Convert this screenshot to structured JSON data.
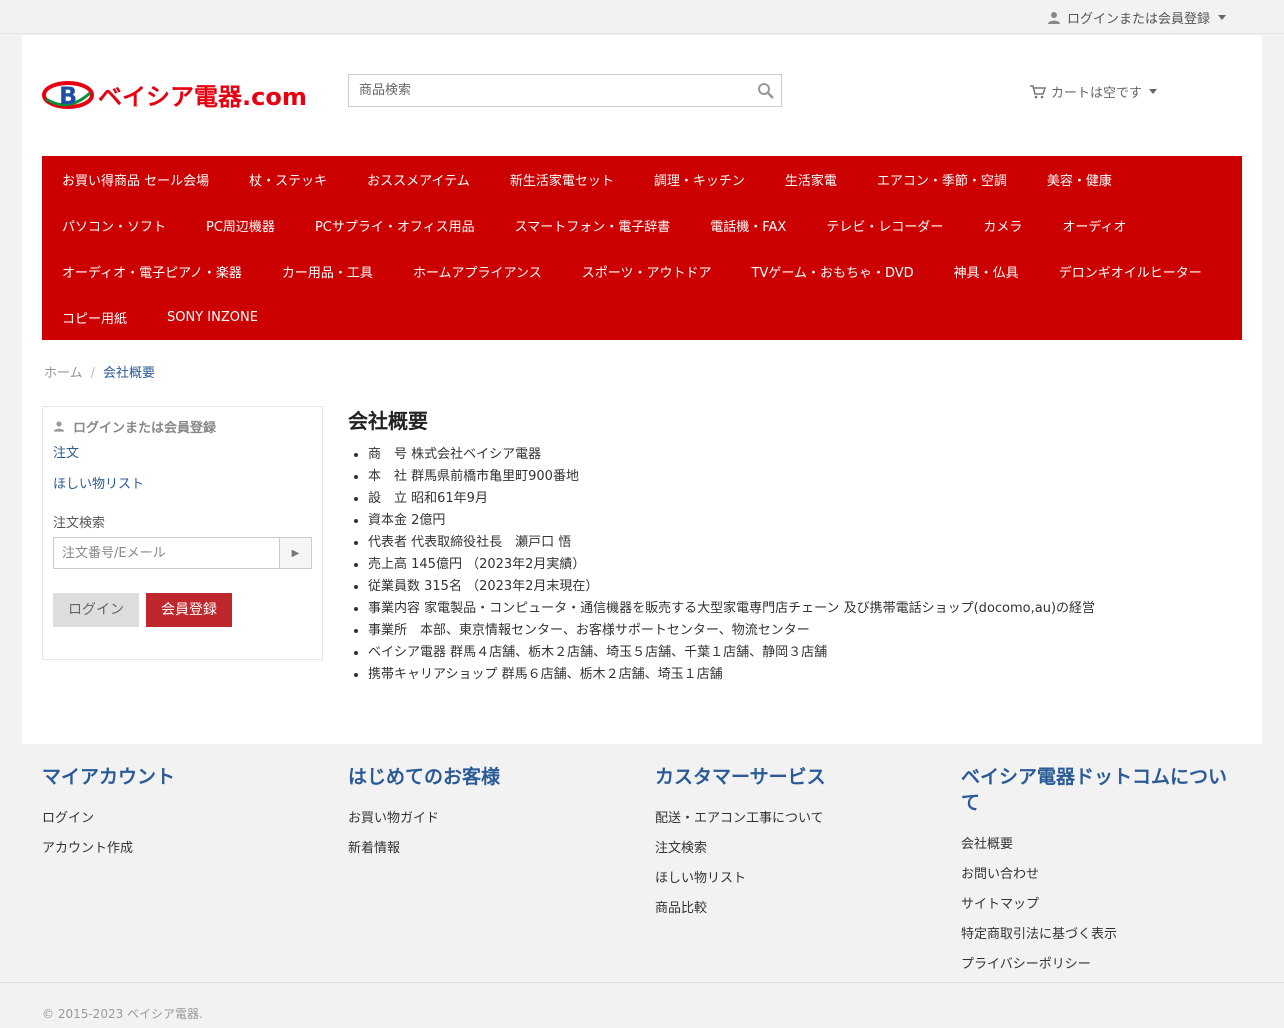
{
  "topbar": {
    "login_label": "ログインまたは会員登録"
  },
  "header": {
    "logo_text": "ベイシア電器.com",
    "search_placeholder": "商品検索",
    "cart_label": "カートは空です"
  },
  "nav": {
    "rows": [
      [
        "お買い得商品 セール会場",
        "杖・ステッキ",
        "おススメアイテム",
        "新生活家電セット",
        "調理・キッチン",
        "生活家電",
        "エアコン・季節・空調",
        "美容・健康"
      ],
      [
        "パソコン・ソフト",
        "PC周辺機器",
        "PCサプライ・オフィス用品",
        "スマートフォン・電子辞書",
        "電話機・FAX",
        "テレビ・レコーダー",
        "カメラ",
        "オーディオ"
      ],
      [
        "オーディオ・電子ピアノ・楽器",
        "カー用品・工具",
        "ホームアプライアンス",
        "スポーツ・アウトドア",
        "TVゲーム・おもちゃ・DVD",
        "神具・仏具",
        "デロンギオイルヒーター"
      ],
      [
        "コピー用紙",
        "SONY INZONE"
      ]
    ]
  },
  "breadcrumb": {
    "home": "ホーム",
    "sep": "/",
    "current": "会社概要"
  },
  "sidebar": {
    "login_label": "ログインまたは会員登録",
    "orders_link": "注文",
    "wishlist_link": "ほしい物リスト",
    "order_search_label": "注文検索",
    "order_search_placeholder": "注文番号/Eメール",
    "login_button": "ログイン",
    "register_button": "会員登録"
  },
  "main": {
    "title": "会社概要",
    "items": [
      "商　号 株式会社ベイシア電器",
      "本　社 群馬県前橋市亀里町900番地",
      "設　立 昭和61年9月",
      "資本金 2億円",
      "代表者 代表取締役社長　瀬戸口 悟",
      "売上高 145億円 （2023年2月実績）",
      "従業員数 315名 （2023年2月末現在）",
      "事業内容 家電製品・コンピュータ・通信機器を販売する大型家電専門店チェーン 及び携帯電話ショップ(docomo,au)の経営",
      "事業所　本部、東京情報センター、お客様サポートセンター、物流センター",
      "ベイシア電器 群馬４店舗、栃木２店舗、埼玉５店舗、千葉１店舗、静岡３店舗",
      "携帯キャリアショップ 群馬６店舗、栃木２店舗、埼玉１店舗"
    ]
  },
  "footer": {
    "columns": [
      {
        "title": "マイアカウント",
        "links": [
          "ログイン",
          "アカウント作成"
        ]
      },
      {
        "title": "はじめてのお客様",
        "links": [
          "お買い物ガイド",
          "新着情報"
        ]
      },
      {
        "title": "カスタマーサービス",
        "links": [
          "配送・エアコン工事について",
          "注文検索",
          "ほしい物リスト",
          "商品比較"
        ]
      },
      {
        "title": "ベイシア電器ドットコムについて",
        "links": [
          "会社概要",
          "お問い合わせ",
          "サイトマップ",
          "特定商取引法に基づく表示",
          "プライバシーポリシー"
        ]
      }
    ],
    "copyright": "© 2015-2023 ベイシア電器."
  },
  "colors": {
    "nav_bg": "#cc0000",
    "link": "#2a5b96",
    "register_button": "#c0272d"
  }
}
